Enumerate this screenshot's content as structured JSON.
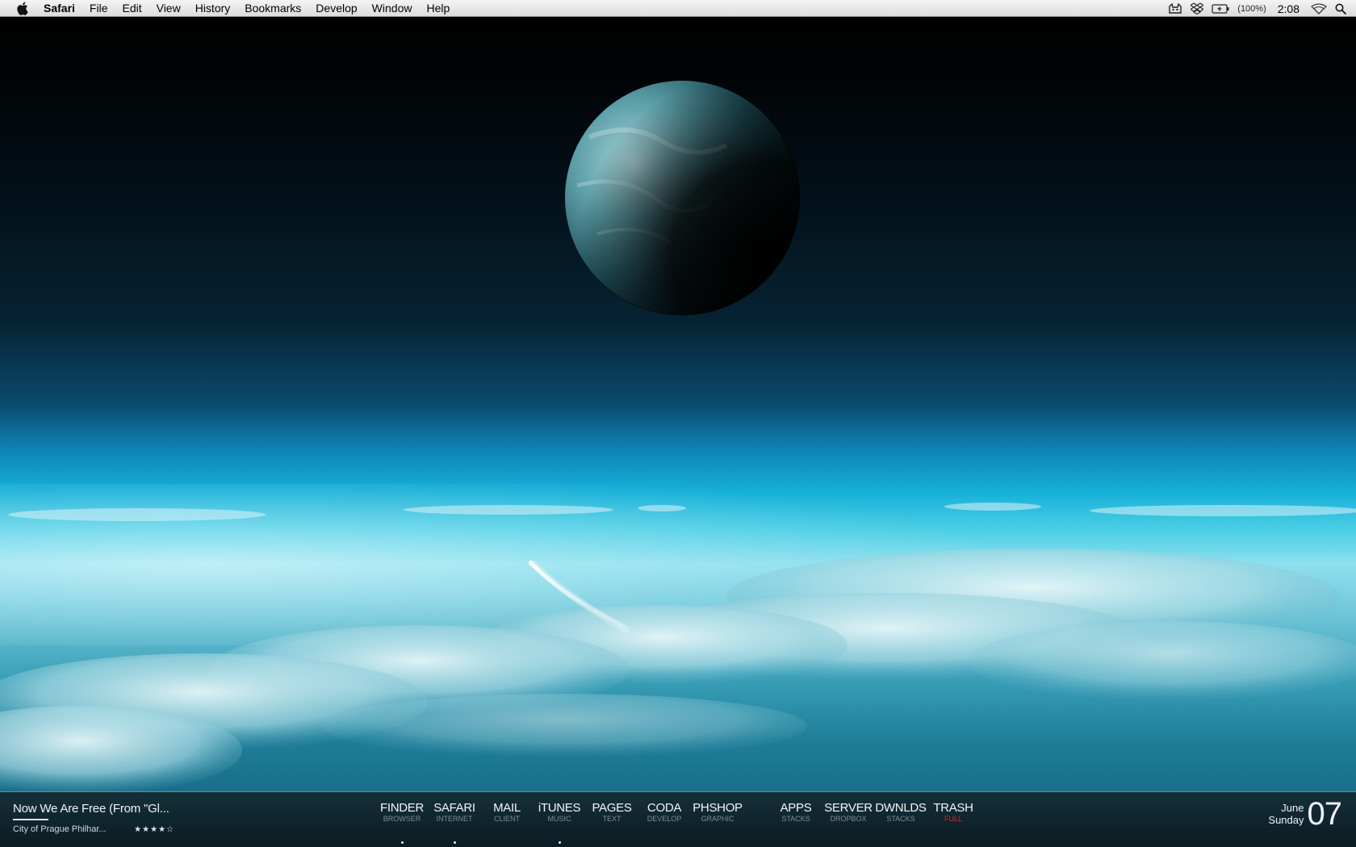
{
  "menubar": {
    "apple_icon": "apple-icon",
    "app_name": "Safari",
    "items": [
      "File",
      "Edit",
      "View",
      "History",
      "Bookmarks",
      "Develop",
      "Window",
      "Help"
    ],
    "status": {
      "battery_percent": "(100%)",
      "clock": "2:08",
      "icons": [
        "cat-icon",
        "dropbox-icon",
        "battery-icon",
        "wifi-icon",
        "spotlight-search-icon"
      ]
    }
  },
  "now_playing": {
    "title": "Now We Are Free (From \"Gl...",
    "artist": "City of Prague Philhar...",
    "rating": 4,
    "rating_text": "★★★★☆",
    "progress": 0.22
  },
  "dock": {
    "items": [
      {
        "label": "FINDER",
        "sub": "BROWSER",
        "running": true
      },
      {
        "label": "SAFARI",
        "sub": "INTERNET",
        "running": true
      },
      {
        "label": "MAIL",
        "sub": "CLIENT",
        "running": false
      },
      {
        "label": "iTUNES",
        "sub": "MUSIC",
        "running": true
      },
      {
        "label": "PAGES",
        "sub": "TEXT",
        "running": false
      },
      {
        "label": "CODA",
        "sub": "DEVELOP",
        "running": false
      },
      {
        "label": "PHSHOP",
        "sub": "GRAPHIC",
        "running": false
      },
      {
        "label": "APPS",
        "sub": "STACKS",
        "running": false
      },
      {
        "label": "SERVER",
        "sub": "DROPBOX",
        "running": false
      },
      {
        "label": "DWNLDS",
        "sub": "STACKS",
        "running": false
      },
      {
        "label": "TRASH",
        "sub": "FULL",
        "running": false,
        "alert": true
      }
    ]
  },
  "date_widget": {
    "month": "June",
    "weekday": "Sunday",
    "day": "07"
  },
  "colors": {
    "menubar_bg": "#e4e4e4",
    "dock_label": "#f2f6f8",
    "dock_sub": "#7e8d94",
    "alert": "#d8262a"
  }
}
